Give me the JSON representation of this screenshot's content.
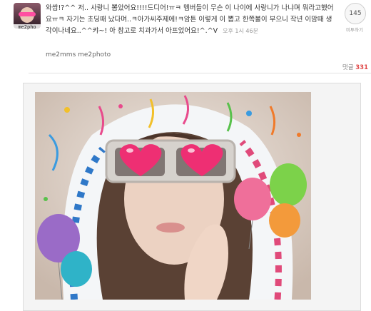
{
  "post": {
    "text": "와쌉!?^^ 저.. 사랑니 뽑았어요!!!!드디어!ㅠㅋ 멤버들이 무슨 이 나이에 사랑니가 나냐며 뭐라고했어요ㅠㅋ 자기는 초딩때 났다며..ㅋ아가씨주제에!ㅋ암튼 이렇게 이 뽑고 한쪽볼이 부으니 작년 이맘때 생각이나네요..^^캬~! 아 참고로 치과가서 아프었어요!^.^V",
    "time": "오후 1시 46분",
    "source": "me2mms me2photo"
  },
  "avatar": {
    "caption": "me2pho"
  },
  "me2day": {
    "count": "145",
    "label": "미투하기"
  },
  "comments": {
    "label": "댓글",
    "count": "331"
  },
  "colors": {
    "accent": "#e04a4a",
    "divider": "#e2e2e2"
  },
  "icons": [
    "heart-icon",
    "balloon-icon"
  ]
}
